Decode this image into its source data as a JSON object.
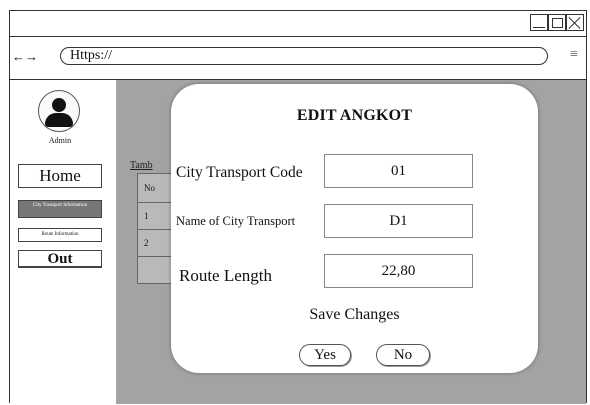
{
  "browser": {
    "nav_arrows": "←→",
    "url": "Https://",
    "menu_glyph": "≡"
  },
  "sidebar": {
    "user_label": "Admin",
    "items": [
      {
        "label": "Home"
      },
      {
        "label": "City Transport Information"
      },
      {
        "label": "Route Information"
      },
      {
        "label": "Out"
      }
    ]
  },
  "background": {
    "link_text": "Tamb",
    "table": {
      "header": "No",
      "rows": [
        "1",
        "2",
        ""
      ]
    }
  },
  "modal": {
    "title": "EDIT ANGKOT",
    "fields": [
      {
        "label": "City Transport Code",
        "value": "01"
      },
      {
        "label": "Name of City Transport",
        "value": "D1"
      },
      {
        "label": "Route Length",
        "value": "22,80"
      }
    ],
    "save_prompt": "Save Changes",
    "yes_label": "Yes",
    "no_label": "No"
  },
  "colors": {
    "overlay": "#a3a3a3",
    "active_nav": "#777777"
  }
}
